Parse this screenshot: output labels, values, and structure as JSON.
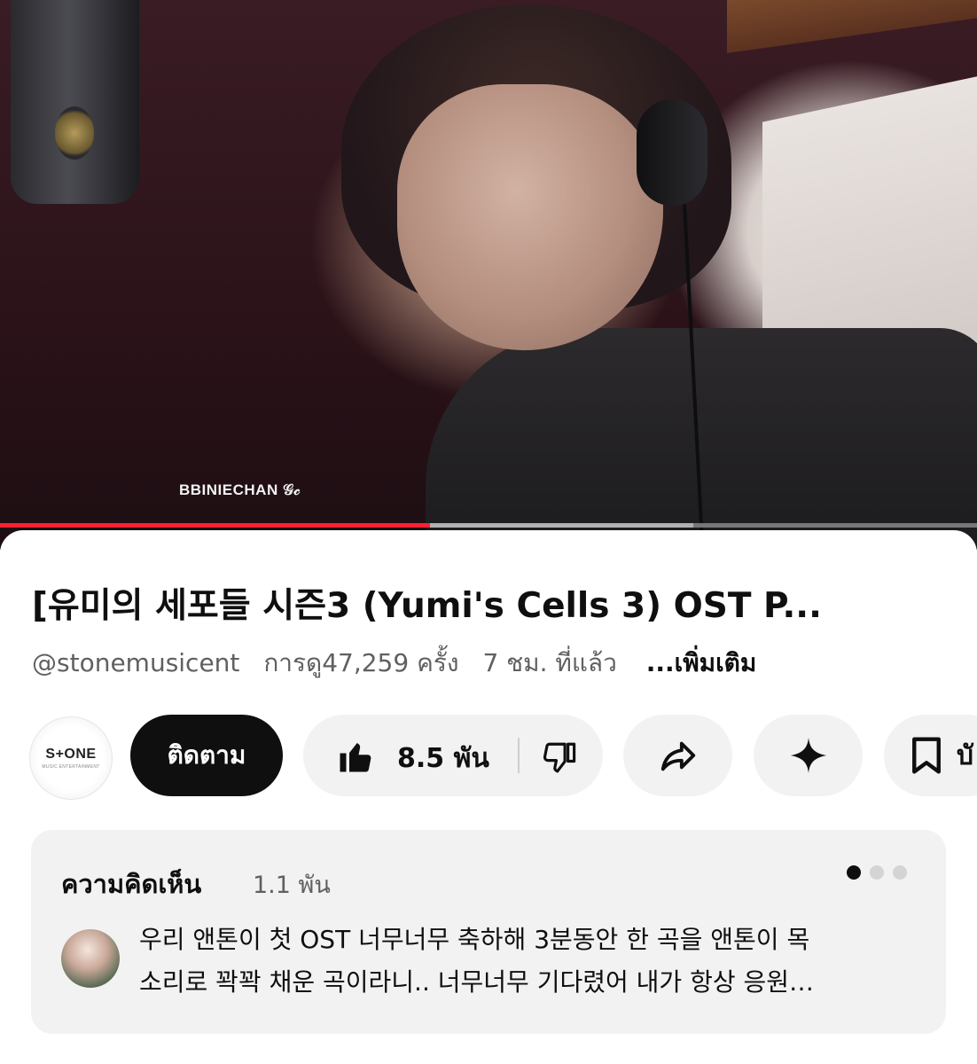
{
  "player": {
    "watermark": "BBINIECHAN 𝒢𝒸",
    "progress_played": 0.44,
    "progress_buffered": 0.71
  },
  "video": {
    "title": "[유미의 세포들 시즌3 (Yumi's Cells 3) OST P...",
    "channel_handle": "@stonemusicent",
    "views": "การดู47,259 ครั้ง",
    "age": "7 ชม. ที่แล้ว",
    "more_label": "...เพิ่มเติม"
  },
  "channel": {
    "logo_text": "S+ONE",
    "logo_sub": "MUSIC ENTERTAINMENT",
    "subscribe_label": "ติดตาม"
  },
  "actions": {
    "like_count": "8.5 พัน",
    "like_icon": "thumbs-up-icon",
    "dislike_icon": "thumbs-down-icon",
    "share_icon": "share-icon",
    "ask_icon": "sparkle-icon",
    "save_icon": "bookmark-icon",
    "save_label": "บั"
  },
  "comments": {
    "heading": "ความคิดเห็น",
    "count": "1.1 พัน",
    "page_dots": 3,
    "active_dot": 0,
    "top_comment_line1": "우리 앤톤이 첫 OST 너무너무 축하해 3분동안 한 곡을 앤톤이 목",
    "top_comment_line2": "소리로 꽉꽉 채운 곡이라니.. 너무너무 기다렸어 내가 항상 응원…"
  },
  "colors": {
    "progress_red": "#ff1f2f",
    "subscribe_bg": "#0f0f0f",
    "pill_bg": "#f2f2f2",
    "secondary_text": "#606060"
  }
}
